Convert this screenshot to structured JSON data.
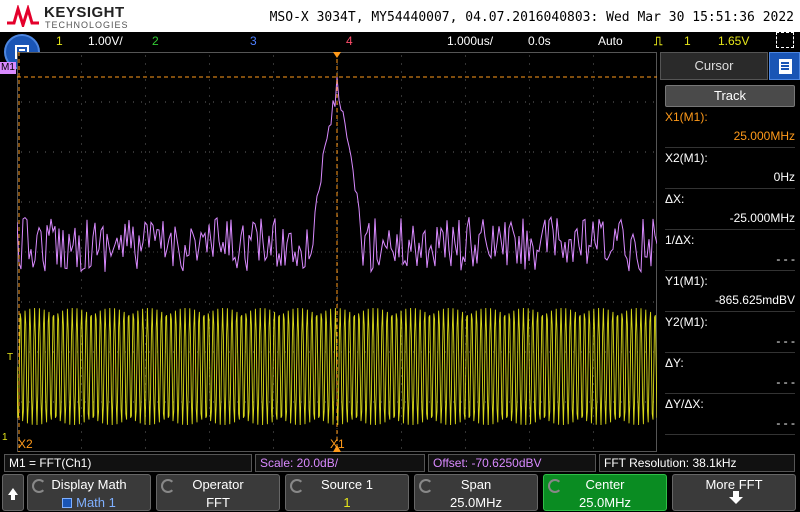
{
  "header": {
    "brand": "KEYSIGHT",
    "sub": "TECHNOLOGIES",
    "title": "MSO-X 3034T, MY54440007, 04.07.2016040803: Wed Mar 30 15:51:36 2022"
  },
  "channels": {
    "ch1": "1",
    "ch1_scale": "1.00V/",
    "ch2": "2",
    "ch3": "3",
    "ch4": "4",
    "timebase": "1.000us/",
    "delay": "0.0s",
    "trigger_mode": "Auto",
    "trigger_src": "1",
    "trigger_level": "1.65V"
  },
  "colors": {
    "ch1": "#e5e51a",
    "ch2": "#33cc33",
    "ch3": "#4d7fff",
    "ch4": "#ff4d6a",
    "math": "#d98aff",
    "cursor": "#ff9a1a",
    "active_softkey": "#0a8c22"
  },
  "scope": {
    "m1_label": "M1",
    "t_label": "T",
    "gnd_label": "1",
    "x1_label": "X1",
    "x2_label": "X2"
  },
  "panel": {
    "tab_label": "Cursor",
    "track_label": "Track",
    "x1_label": "X1(M1):",
    "x1_value": "25.000MHz",
    "x2_label": "X2(M1):",
    "x2_value": "0Hz",
    "dx_label": "ΔX:",
    "dx_value": "-25.000MHz",
    "inv_dx_label": "1/ΔX:",
    "inv_dx_value": "- - -",
    "y1_label": "Y1(M1):",
    "y1_value": "-865.625mdBV",
    "y2_label": "Y2(M1):",
    "y2_value": "- - -",
    "dy_label": "ΔY:",
    "dy_value": "- - -",
    "dydx_label": "ΔY/ΔX:",
    "dydx_value": "- - -"
  },
  "status": {
    "math_def": "M1 = FFT(Ch1)",
    "scale": "Scale: 20.0dB/",
    "offset": "Offset: -70.6250dBV",
    "resolution": "FFT Resolution: 38.1kHz"
  },
  "softkeys": {
    "display_math_title": "Display Math",
    "display_math_value": "Math 1",
    "operator_title": "Operator",
    "operator_value": "FFT",
    "source_title": "Source 1",
    "source_value": "1",
    "span_title": "Span",
    "span_value": "25.0MHz",
    "center_title": "Center",
    "center_value": "25.0MHz",
    "more_title": "More FFT"
  }
}
